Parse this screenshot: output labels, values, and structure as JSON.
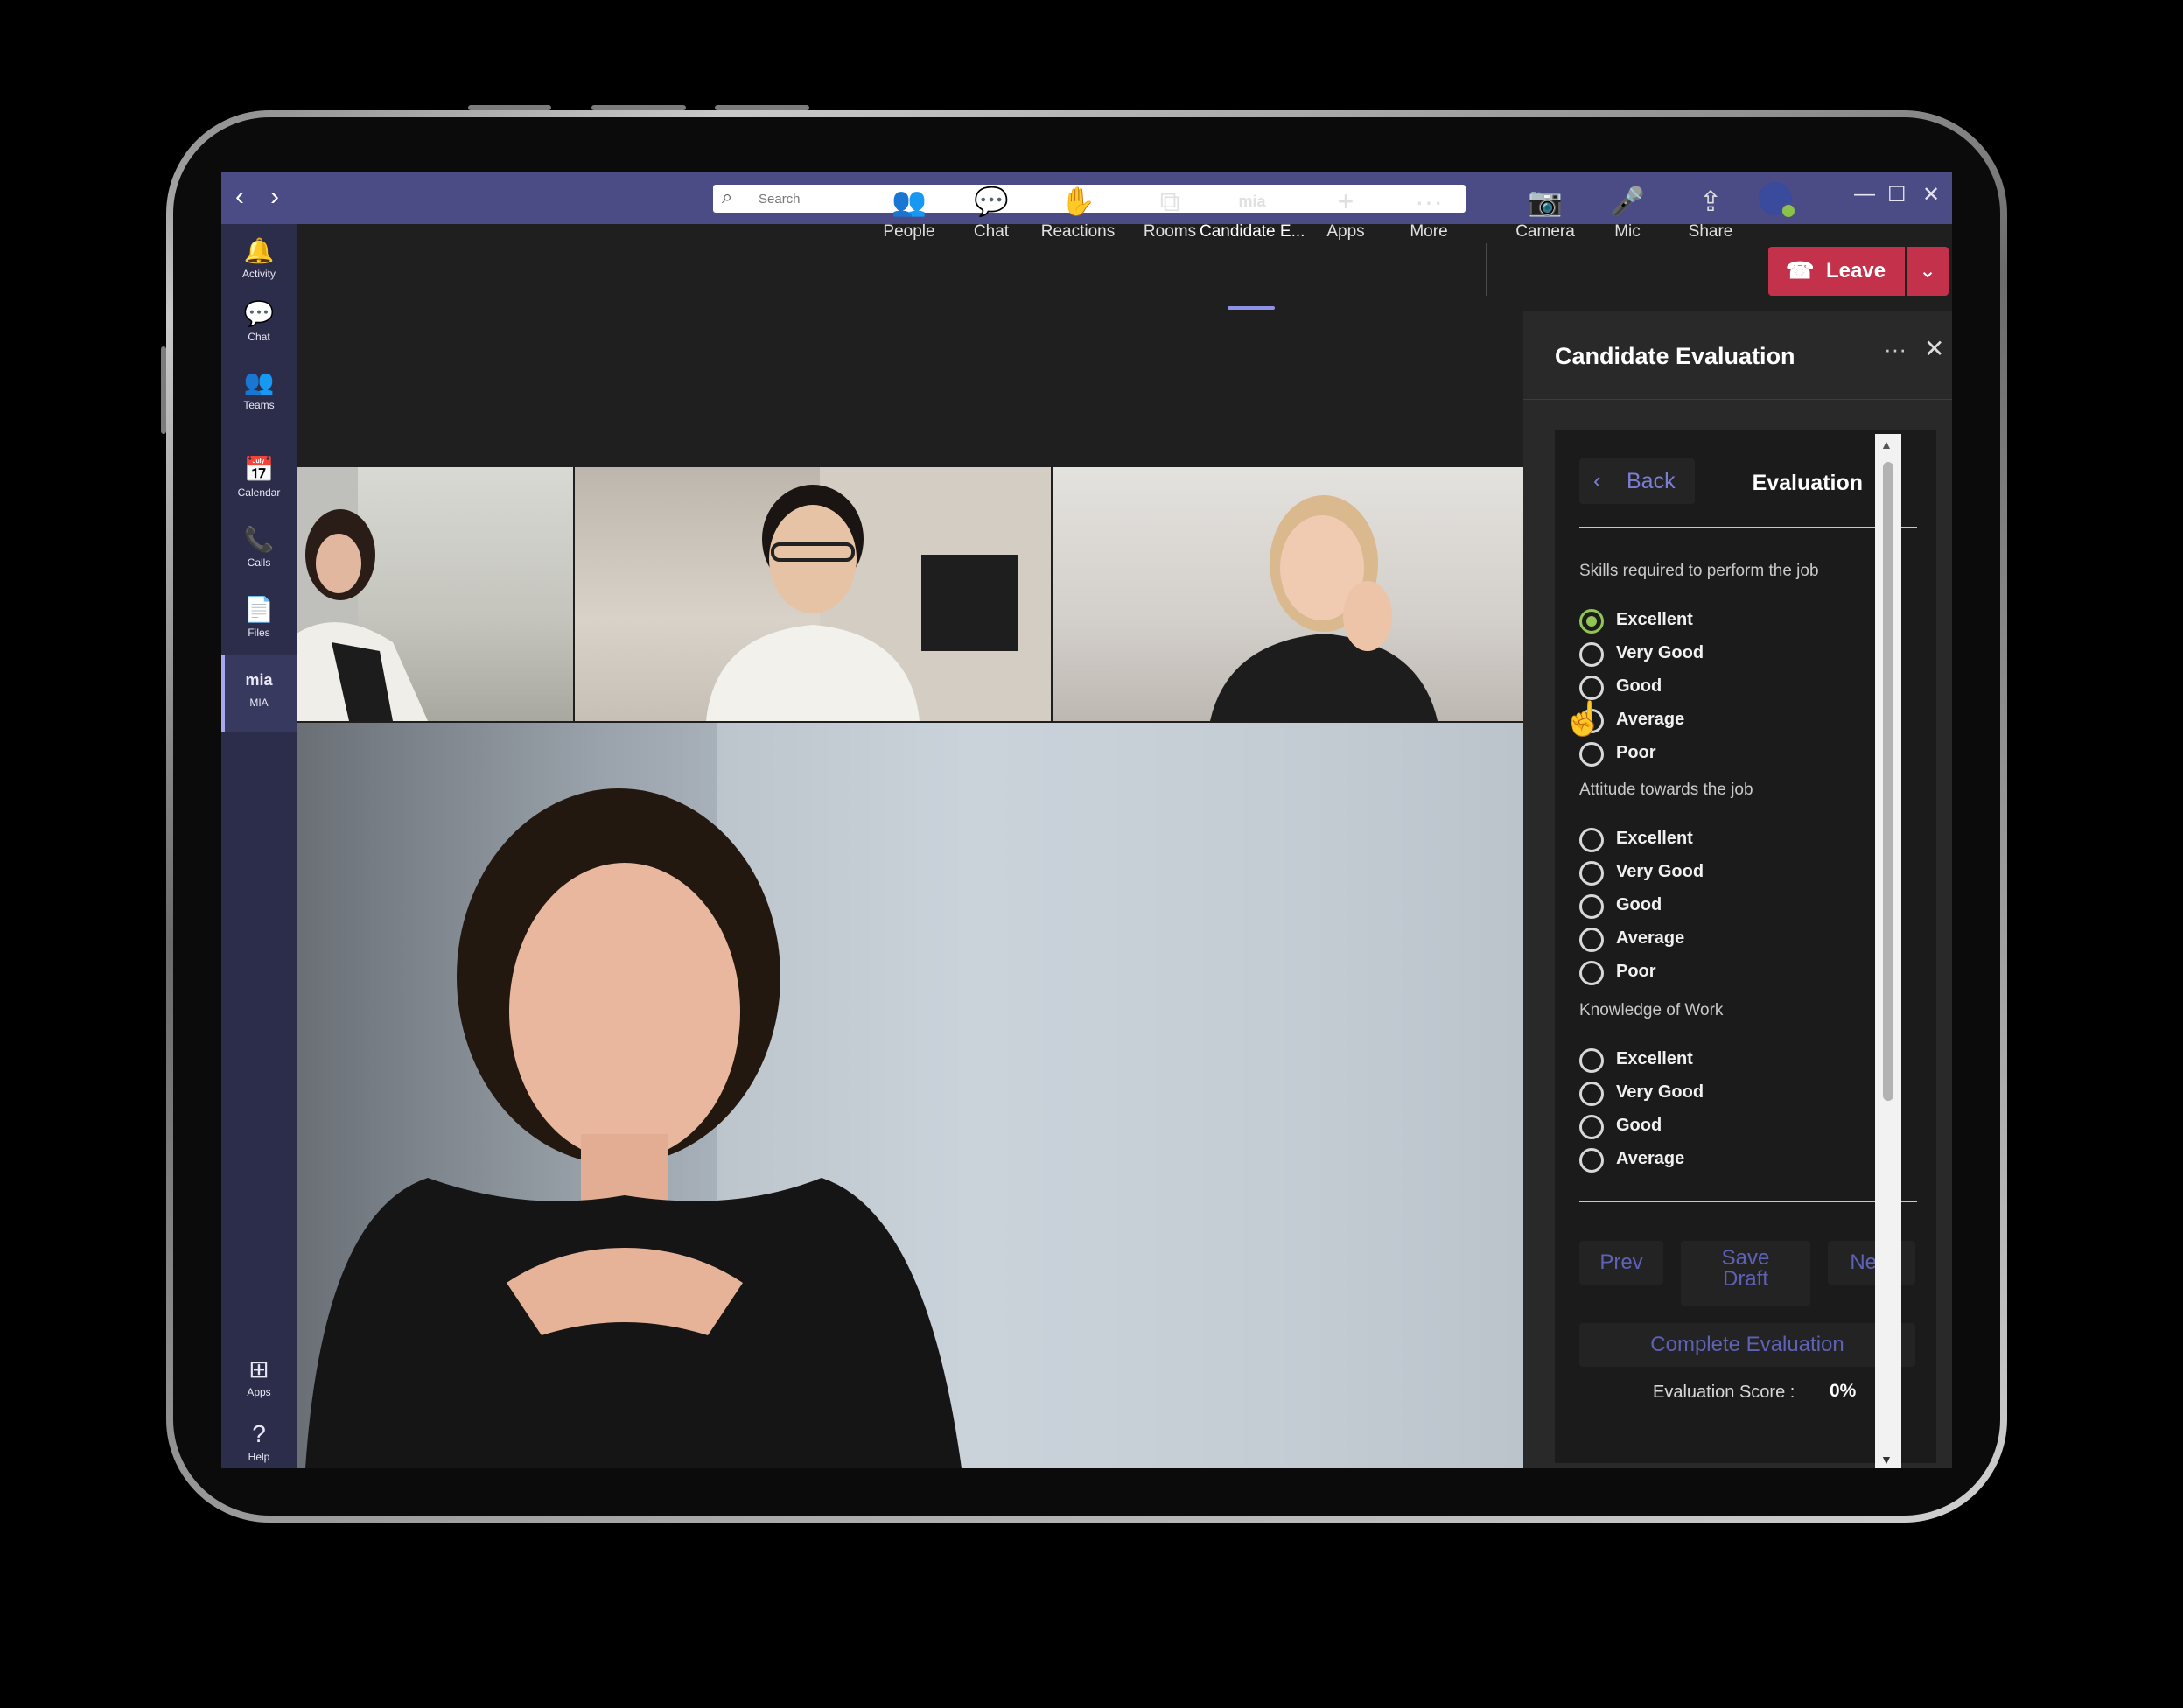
{
  "titlebar": {
    "back_arrow": "‹",
    "forward_arrow": "›",
    "search_placeholder": "Search",
    "search_icon": "search-icon",
    "window_minimize": "—",
    "window_maximize": "☐",
    "window_close": "✕"
  },
  "rail": {
    "items": [
      {
        "label": "Activity",
        "icon": "bell-icon",
        "glyph": "🔔"
      },
      {
        "label": "Chat",
        "icon": "chat-icon",
        "glyph": "💬"
      },
      {
        "label": "Teams",
        "icon": "teams-icon",
        "glyph": "👥"
      },
      {
        "label": "Calendar",
        "icon": "calendar-icon",
        "glyph": "📅"
      },
      {
        "label": "Calls",
        "icon": "phone-icon",
        "glyph": "📞"
      },
      {
        "label": "Files",
        "icon": "file-icon",
        "glyph": "📄"
      },
      {
        "label": "MIA",
        "icon": "mia-icon",
        "glyph": "mia"
      },
      {
        "label": "Apps",
        "icon": "apps-icon",
        "glyph": "⊞"
      },
      {
        "label": "Help",
        "icon": "help-icon",
        "glyph": "?"
      }
    ]
  },
  "toolbar": {
    "tools": [
      {
        "label": "People",
        "glyph": "👥"
      },
      {
        "label": "Chat",
        "glyph": "💬"
      },
      {
        "label": "Reactions",
        "glyph": "✋"
      },
      {
        "label": "Rooms",
        "glyph": "⧉"
      },
      {
        "label": "Candidate E...",
        "glyph": "mia"
      },
      {
        "label": "Apps",
        "glyph": "+"
      },
      {
        "label": "More",
        "glyph": "···"
      },
      {
        "label": "Camera",
        "glyph": "📷"
      },
      {
        "label": "Mic",
        "glyph": "🎤"
      },
      {
        "label": "Share",
        "glyph": "⇪"
      }
    ],
    "leave_label": "Leave",
    "leave_glyph": "☎",
    "leave_dropdown_glyph": "⌄"
  },
  "panel": {
    "title": "Candidate Evaluation",
    "more_glyph": "···",
    "close_glyph": "✕",
    "back_label": "Back",
    "back_glyph": "‹",
    "section_title": "Evaluation",
    "questions": [
      {
        "label": "Skills required to perform the job",
        "options": [
          "Excellent",
          "Very Good",
          "Good",
          "Average",
          "Poor"
        ],
        "selected": 0
      },
      {
        "label": "Attitude towards the job",
        "options": [
          "Excellent",
          "Very Good",
          "Good",
          "Average",
          "Poor"
        ],
        "selected": -1
      },
      {
        "label": "Knowledge of Work",
        "options": [
          "Excellent",
          "Very Good",
          "Good",
          "Average"
        ],
        "selected": -1
      }
    ],
    "prev_label": "Prev",
    "save_label_line1": "Save",
    "save_label_line2": "Draft",
    "next_label": "Next",
    "complete_label": "Complete Evaluation",
    "score_label": "Evaluation Score :",
    "score_value": "0%"
  },
  "colors": {
    "titlebar": "#4b4c86",
    "rail": "#2c2d4a",
    "accent": "#7b7ed6",
    "leave": "#c4314b",
    "selected_radio": "#92c353"
  }
}
